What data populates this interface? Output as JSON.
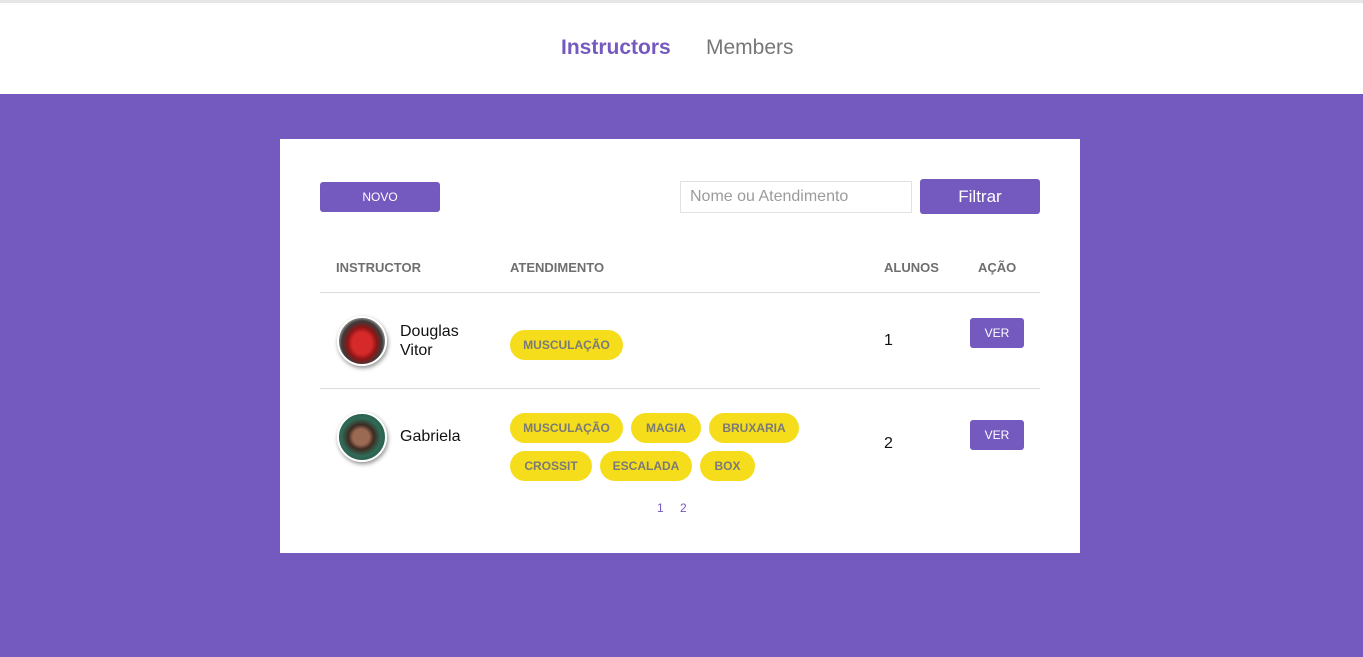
{
  "nav": {
    "instructors_label": "Instructors",
    "members_label": "Members"
  },
  "toolbar": {
    "new_label": "NOVO",
    "search_placeholder": "Nome ou Atendimento",
    "filter_label": "Filtrar"
  },
  "table": {
    "headers": [
      "INSTRUCTOR",
      "ATENDIMENTO",
      "ALUNOS",
      "AÇÃO"
    ],
    "rows": [
      {
        "name": "Douglas Vitor",
        "avatar_icon": "red-car-photo",
        "services": [
          "MUSCULAÇÃO"
        ],
        "students": "1",
        "action": "VER"
      },
      {
        "name": "Gabriela",
        "avatar_icon": "woman-portrait-photo",
        "services": [
          "MUSCULAÇÃO",
          "MAGIA",
          "BRUXARIA",
          "CROSSIT",
          "ESCALADA",
          "BOX"
        ],
        "students": "2",
        "action": "VER"
      }
    ]
  },
  "pagination": {
    "pages": [
      "1",
      "2"
    ]
  },
  "colors": {
    "accent": "#7459bf",
    "pill": "#f5dd1c",
    "background": "#7459bf"
  }
}
